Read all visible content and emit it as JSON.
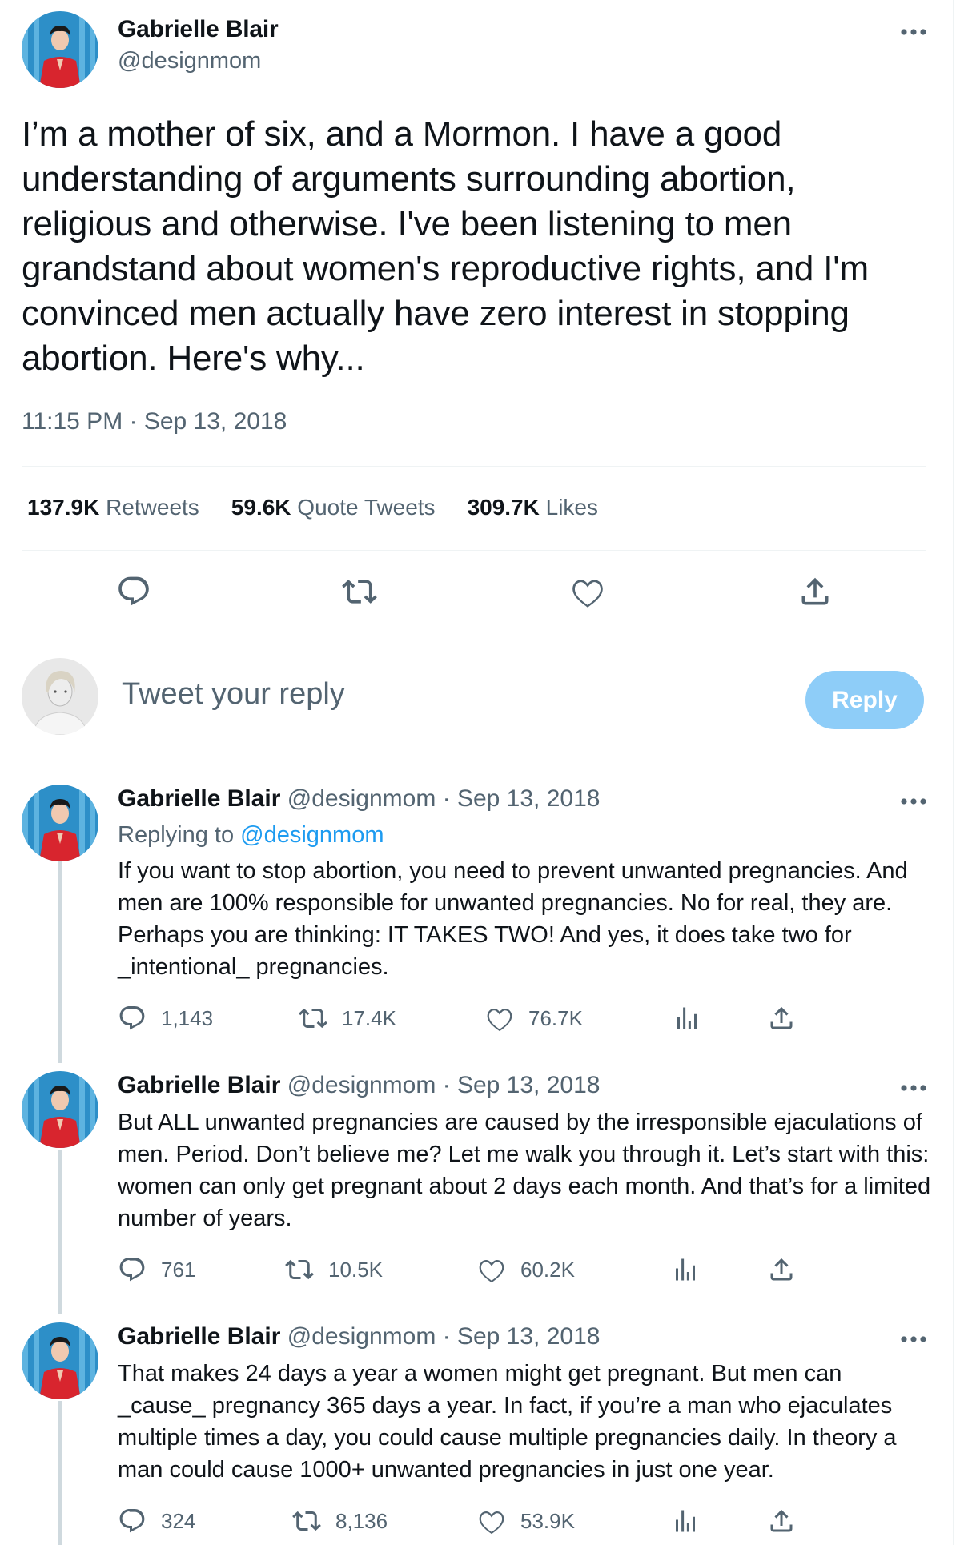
{
  "main_tweet": {
    "name": "Gabrielle Blair",
    "handle": "@designmom",
    "text": "I’m a mother of six, and a Mormon. I have a good understanding of arguments surrounding abortion, religious and otherwise. I've been listening to men grandstand about women's reproductive rights, and I'm convinced men actually have zero interest in stopping abortion. Here's why...",
    "timestamp": "11:15 PM · Sep 13, 2018",
    "stats": {
      "retweets_count": "137.9K",
      "retweets_label": "Retweets",
      "quotes_count": "59.6K",
      "quotes_label": "Quote Tweets",
      "likes_count": "309.7K",
      "likes_label": "Likes"
    }
  },
  "composer": {
    "placeholder": "Tweet your reply",
    "button_label": "Reply"
  },
  "thread": [
    {
      "name": "Gabrielle Blair",
      "meta": "@designmom · Sep 13, 2018",
      "replying_prefix": "Replying to",
      "replying_handle": "@designmom",
      "text": "If you want to stop abortion, you need to prevent unwanted pregnancies. And men are 100% responsible for unwanted pregnancies. No for real, they are. Perhaps you are thinking: IT TAKES TWO! And yes, it does take two for _intentional_ pregnancies.",
      "replies": "1,143",
      "retweets": "17.4K",
      "likes": "76.7K"
    },
    {
      "name": "Gabrielle Blair",
      "meta": "@designmom · Sep 13, 2018",
      "text": "But ALL unwanted pregnancies are caused by the irresponsible ejaculations of men. Period. Don’t believe me? Let me walk you through it. Let’s start with this: women can only get pregnant about 2 days each month. And that’s for a limited number of years.",
      "replies": "761",
      "retweets": "10.5K",
      "likes": "60.2K"
    },
    {
      "name": "Gabrielle Blair",
      "meta": "@designmom · Sep 13, 2018",
      "text": "That makes 24 days a year a women might get pregnant. But men can _cause_ pregnancy 365 days a year. In fact, if you’re a man who ejaculates multiple times a day, you could cause multiple pregnancies daily. In theory a man could cause 1000+ unwanted pregnancies in just one year.",
      "replies": "324",
      "retweets": "8,136",
      "likes": "53.9K"
    }
  ],
  "colors": {
    "text": "#0f1419",
    "secondary": "#536471",
    "link": "#1d9bf0",
    "reply_button_disabled": "#8ecdf8",
    "divider": "#eff3f4"
  },
  "icons": [
    "more-icon",
    "reply-icon",
    "retweet-icon",
    "like-icon",
    "share-icon",
    "analytics-icon"
  ]
}
